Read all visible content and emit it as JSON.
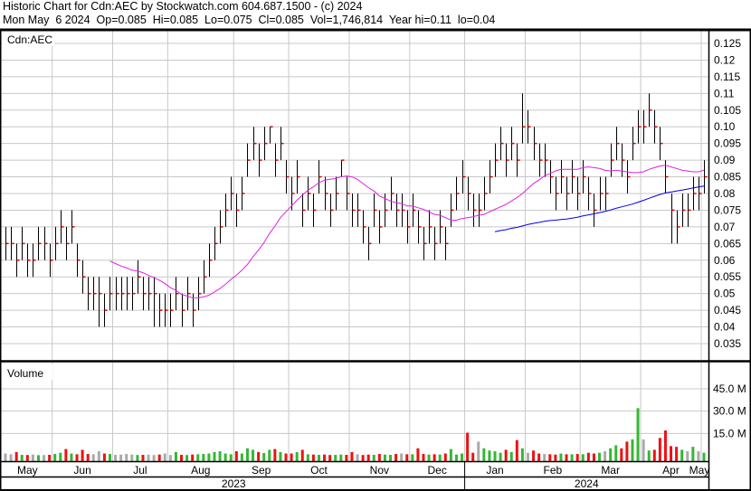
{
  "header": {
    "line1": "Historic Chart for Cdn:AEC by Stockwatch.com 604.687.1500 - (c) 2024",
    "line2": "Mon May  6 2024  Op=0.085  Hi=0.085  Lo=0.075  Cl=0.085  Vol=1,746,814  Year hi=0.11  lo=0.04"
  },
  "chart_data": {
    "type": "ohlc",
    "symbol_label": "Cdn:AEC",
    "volume_label": "Volume",
    "price_ticks": [
      "0.125",
      "0.12",
      "0.115",
      "0.11",
      "0.105",
      "0.10",
      "0.095",
      "0.09",
      "0.085",
      "0.08",
      "0.075",
      "0.07",
      "0.065",
      "0.06",
      "0.055",
      "0.05",
      "0.045",
      "0.04",
      "0.035"
    ],
    "price_ylim": [
      0.035,
      0.125
    ],
    "volume_ticks": [
      "45.0 M",
      "30.0 M",
      "15.0 M"
    ],
    "volume_tick_values": [
      45,
      30,
      15
    ],
    "months": [
      {
        "label": "May",
        "start": 0
      },
      {
        "label": "Jun",
        "start": 9
      },
      {
        "label": "Jul",
        "start": 20
      },
      {
        "label": "Aug",
        "start": 30
      },
      {
        "label": "Sep",
        "start": 42
      },
      {
        "label": "Oct",
        "start": 52
      },
      {
        "label": "Nov",
        "start": 63
      },
      {
        "label": "Dec",
        "start": 74
      },
      {
        "label": "Jan",
        "start": 84
      },
      {
        "label": "Feb",
        "start": 95
      },
      {
        "label": "Mar",
        "start": 105
      },
      {
        "label": "Apr",
        "start": 116
      },
      {
        "label": "May",
        "start": 127
      }
    ],
    "years": [
      {
        "label": "2023",
        "start": 0
      },
      {
        "label": "2024",
        "start": 84
      }
    ],
    "closes": [
      0.065,
      0.065,
      0.06,
      0.065,
      0.06,
      0.06,
      0.065,
      0.065,
      0.06,
      0.065,
      0.07,
      0.065,
      0.07,
      0.06,
      0.055,
      0.05,
      0.05,
      0.05,
      0.045,
      0.05,
      0.05,
      0.05,
      0.05,
      0.05,
      0.055,
      0.05,
      0.05,
      0.05,
      0.045,
      0.045,
      0.045,
      0.05,
      0.045,
      0.05,
      0.045,
      0.05,
      0.055,
      0.06,
      0.065,
      0.07,
      0.075,
      0.08,
      0.075,
      0.08,
      0.09,
      0.095,
      0.09,
      0.095,
      0.1,
      0.09,
      0.095,
      0.085,
      0.08,
      0.085,
      0.075,
      0.08,
      0.075,
      0.085,
      0.08,
      0.075,
      0.08,
      0.09,
      0.08,
      0.075,
      0.075,
      0.07,
      0.065,
      0.075,
      0.07,
      0.075,
      0.08,
      0.075,
      0.075,
      0.07,
      0.075,
      0.07,
      0.065,
      0.07,
      0.065,
      0.07,
      0.065,
      0.075,
      0.08,
      0.085,
      0.08,
      0.075,
      0.075,
      0.08,
      0.085,
      0.09,
      0.095,
      0.09,
      0.095,
      0.09,
      0.1,
      0.1,
      0.095,
      0.09,
      0.09,
      0.085,
      0.08,
      0.085,
      0.08,
      0.085,
      0.08,
      0.085,
      0.08,
      0.075,
      0.08,
      0.08,
      0.09,
      0.095,
      0.09,
      0.085,
      0.095,
      0.1,
      0.1,
      0.105,
      0.1,
      0.095,
      0.085,
      0.075,
      0.07,
      0.075,
      0.075,
      0.08,
      0.08,
      0.085
    ],
    "bar_range": 0.005,
    "high_overrides": {
      "94": 0.11,
      "117": 0.11,
      "48": 0.1,
      "61": 0.09,
      "10": 0.075,
      "12": 0.075
    },
    "low_overrides": {
      "17": 0.04,
      "27": 0.04,
      "66": 0.06,
      "122": 0.065,
      "121": 0.065
    },
    "volumes_millions": [
      1.5,
      1,
      2.5,
      0.6,
      0.5,
      0.8,
      0.4,
      0.5,
      0.6,
      1.2,
      2,
      4.5,
      1.5,
      1,
      4,
      1.2,
      1,
      3,
      1.5,
      1.2,
      0.6,
      0.8,
      1.2,
      0.8,
      0.5,
      0.6,
      0.7,
      0.5,
      0.8,
      1.5,
      0.5,
      2.5,
      0.6,
      0.5,
      0.8,
      1,
      1.2,
      1.5,
      2.5,
      3,
      1.5,
      1,
      3,
      1.5,
      5,
      4,
      2.5,
      1.8,
      4,
      4.5,
      2.5,
      1.5,
      1.5,
      2.5,
      4,
      1,
      0.8,
      0.6,
      0.8,
      0.5,
      0.6,
      0.8,
      0.6,
      2.5,
      1,
      0.5,
      0.8,
      0.6,
      1.2,
      0.8,
      0.6,
      1.2,
      1.5,
      1,
      1,
      5,
      1.2,
      0.8,
      1,
      0.8,
      1.5,
      4.5,
      0.8,
      1.5,
      15.5,
      2,
      9.5,
      5,
      3.5,
      3,
      2,
      4,
      2.5,
      10.5,
      5,
      2,
      3.5,
      1.5,
      1.2,
      1,
      0.8,
      1.5,
      1,
      1,
      1.2,
      1,
      2,
      1.5,
      2,
      3,
      5,
      7,
      5,
      9.5,
      11,
      32,
      11,
      3.5,
      4,
      12,
      17,
      6.5,
      6,
      4,
      3,
      6,
      3,
      2
    ],
    "moving_averages": [
      {
        "name": "short MA",
        "period": 20,
        "color": "#e020e0"
      },
      {
        "name": "long MA",
        "period": 90,
        "color": "#0000e0"
      }
    ],
    "colors": {
      "up": "#33b833",
      "down": "#ee1111",
      "unchanged": "#aaaaaa",
      "close_tick": "#dd0000",
      "grid": "#c8c8c8"
    }
  }
}
